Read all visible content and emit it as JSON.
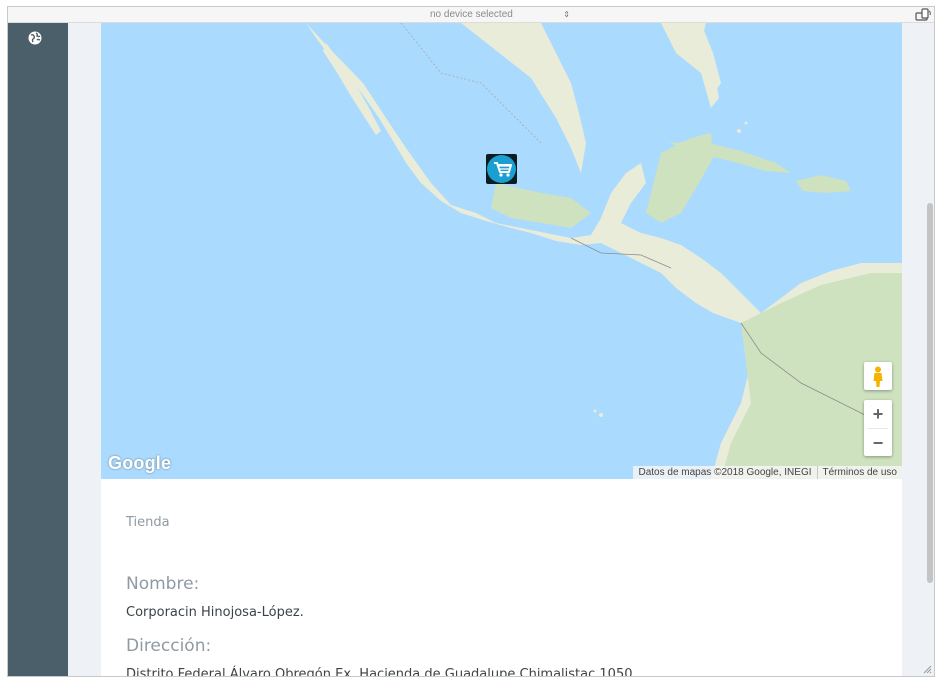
{
  "window": {
    "device_select": {
      "value": "no device selected"
    },
    "icons": {
      "rotate": "rotate-device-icon",
      "globe": "globe-icon"
    }
  },
  "map": {
    "logo": "Google",
    "attribution": "Datos de mapas ©2018 Google, INEGI",
    "terms": "Términos de uso",
    "zoom_in": "+",
    "zoom_out": "−",
    "marker_icon": "shopping-cart-icon",
    "colors": {
      "water": "#abdaff",
      "land": "#e8ecd8",
      "marker": "#1aa0d0"
    }
  },
  "store": {
    "type": "Tienda",
    "name_label": "Nombre:",
    "name_value": "Corporacin Hinojosa-López.",
    "address_label": "Dirección:",
    "address_value": "Distrito Federal Álvaro Obregón Ex. Hacienda de Guadalupe Chimalistac 1050"
  }
}
